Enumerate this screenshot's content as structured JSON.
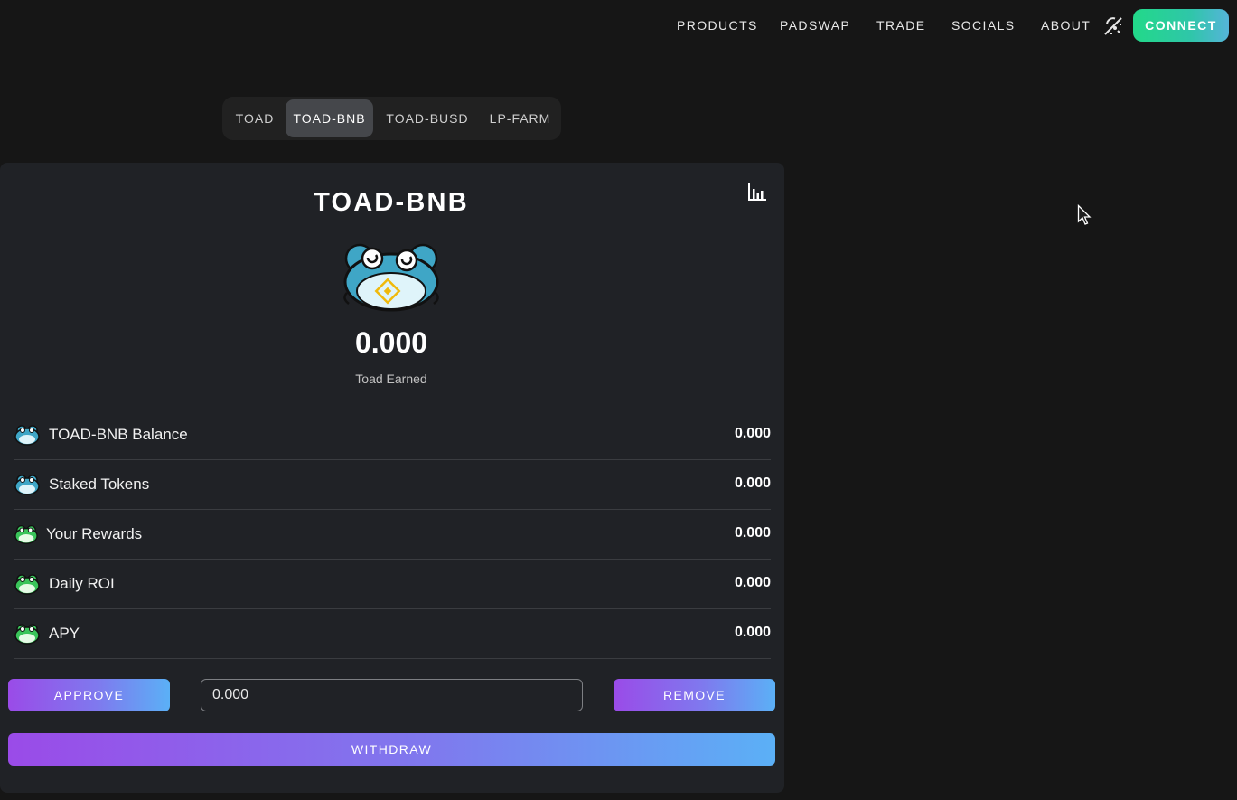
{
  "nav": {
    "items": [
      "PRODUCTS",
      "PADSWAP",
      "TRADE",
      "SOCIALS",
      "ABOUT"
    ],
    "theme_icon": "theme-toggle-icon",
    "connect_label": "CONNECT"
  },
  "tabs": [
    {
      "label": "TOAD",
      "active": false
    },
    {
      "label": "TOAD-BNB",
      "active": true
    },
    {
      "label": "TOAD-BUSD",
      "active": false
    },
    {
      "label": "LP-FARM",
      "active": false
    }
  ],
  "card": {
    "title": "TOAD-BNB",
    "chart_icon": "bar-chart-icon",
    "earned_value": "0.000",
    "earned_label": "Toad Earned",
    "stats": [
      {
        "label": "TOAD-BNB Balance",
        "value": "0.000",
        "icon": "toad-blue-icon"
      },
      {
        "label": "Staked Tokens",
        "value": "0.000",
        "icon": "toad-blue-icon"
      },
      {
        "label": "Your Rewards",
        "value": "0.000",
        "icon": "toad-green-icon"
      },
      {
        "label": "Daily ROI",
        "value": "0.000",
        "icon": "toad-green-icon"
      },
      {
        "label": "APY",
        "value": "0.000",
        "icon": "toad-green-icon"
      }
    ],
    "approve_label": "APPROVE",
    "amount_value": "0.000",
    "remove_label": "REMOVE",
    "withdraw_label": "WITHDRAW"
  },
  "colors": {
    "background": "#161616",
    "card": "#202226",
    "connect_gradient": [
      "#22d989",
      "#55b4d9"
    ],
    "button_gradient": [
      "#9a4be8",
      "#5bb0f6"
    ]
  }
}
